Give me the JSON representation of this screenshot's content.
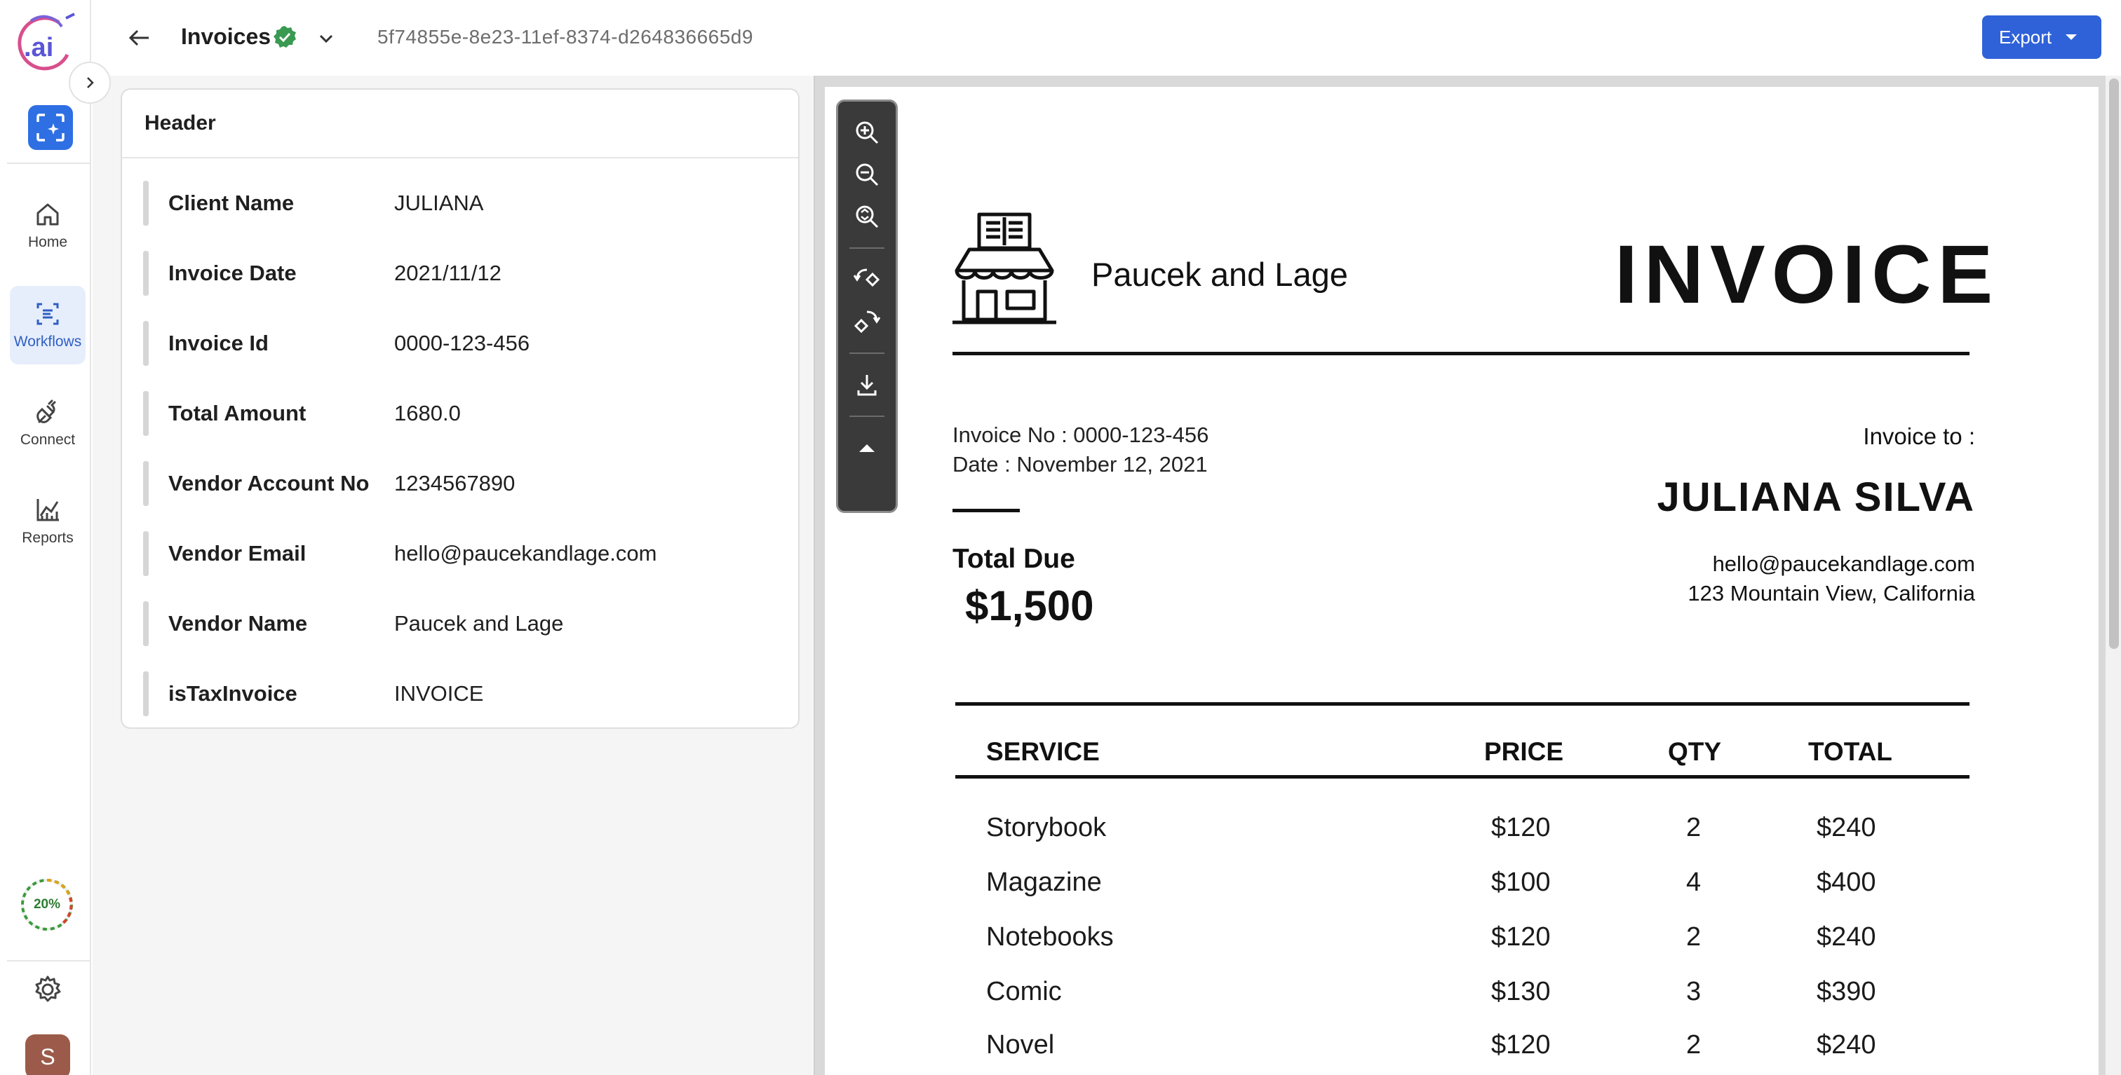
{
  "rail": {
    "logo_text": ".ai",
    "nav": [
      {
        "label": "Home",
        "icon": "home-icon"
      },
      {
        "label": "Workflows",
        "icon": "workflows-icon",
        "active": true
      },
      {
        "label": "Connect",
        "icon": "plug-icon"
      },
      {
        "label": "Reports",
        "icon": "chart-icon"
      }
    ],
    "progress_label": "20%",
    "progress_value": 0.2,
    "avatar_initial": "S"
  },
  "topbar": {
    "title": "Invoices",
    "doc_id": "5f74855e-8e23-11ef-8374-d264836665d9",
    "export_label": "Export"
  },
  "fields": {
    "section_title": "Header",
    "items": [
      {
        "name": "Client Name",
        "value": "JULIANA"
      },
      {
        "name": "Invoice Date",
        "value": "2021/11/12"
      },
      {
        "name": "Invoice Id",
        "value": "0000-123-456"
      },
      {
        "name": "Total Amount",
        "value": "1680.0"
      },
      {
        "name": "Vendor Account No",
        "value": "1234567890"
      },
      {
        "name": "Vendor Email",
        "value": "hello@paucekandlage.com"
      },
      {
        "name": "Vendor Name",
        "value": "Paucek and Lage"
      },
      {
        "name": "isTaxInvoice",
        "value": "INVOICE"
      }
    ]
  },
  "invoice": {
    "company": "Paucek and Lage",
    "title": "INVOICE",
    "invoice_no": "Invoice No : 0000-123-456",
    "date": "Date : November 12, 2021",
    "total_due_label": "Total Due",
    "total_due": "$1,500",
    "invoice_to": "Invoice to :",
    "client": "JULIANA SILVA",
    "client_email": "hello@paucekandlage.com",
    "client_address": "123 Mountain View, California",
    "columns": [
      "SERVICE",
      "PRICE",
      "QTY",
      "TOTAL"
    ],
    "rows": [
      [
        "Storybook",
        "$120",
        "2",
        "$240"
      ],
      [
        "Magazine",
        "$100",
        "4",
        "$400"
      ],
      [
        "Notebooks",
        "$120",
        "2",
        "$240"
      ],
      [
        "Comic",
        "$130",
        "3",
        "$390"
      ],
      [
        "Novel",
        "$120",
        "2",
        "$240"
      ]
    ]
  },
  "colors": {
    "accent": "#2f62d9",
    "active_nav_bg": "#e6eefc",
    "verified_green": "#3a9a52",
    "toolbar_bg": "#3a3a3a"
  }
}
